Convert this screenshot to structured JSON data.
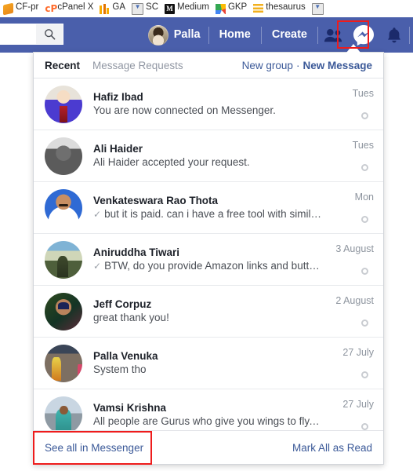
{
  "bookmarks": [
    {
      "label": "CF-pr",
      "icon": "cfpr-icon"
    },
    {
      "label": "cPanel X",
      "icon": "cpanel-icon"
    },
    {
      "label": "GA",
      "icon": "google-analytics-icon"
    },
    {
      "label": "SC",
      "icon": "search-console-icon"
    },
    {
      "label": "Medium",
      "icon": "medium-icon"
    },
    {
      "label": "GKP",
      "icon": "google-keyword-planner-icon"
    },
    {
      "label": "thesaurus",
      "icon": "thesaurus-icon"
    },
    {
      "label": "",
      "icon": "chevron-down-icon"
    }
  ],
  "navbar": {
    "search_placeholder": "",
    "search_value": "",
    "search_icon": "search-icon",
    "profile_name": "Palla",
    "home_label": "Home",
    "create_label": "Create",
    "friends_icon": "friend-requests-icon",
    "messenger_icon": "messenger-icon",
    "notifications_icon": "bell-icon",
    "accent_blue": "#4a5fab",
    "highlight_color": "#ee1c1c"
  },
  "dropdown": {
    "tab_recent": "Recent",
    "tab_message_requests": "Message Requests",
    "new_group_label": "New group",
    "separator": "·",
    "new_message_label": "New Message",
    "link_color": "#3b5998",
    "threads": [
      {
        "name": "Hafiz Ibad",
        "snippet": "You are now connected on Messenger.",
        "time": "Tues",
        "has_tick": false,
        "avatar": "av1"
      },
      {
        "name": "Ali Haider",
        "snippet": "Ali Haider accepted your request.",
        "time": "Tues",
        "has_tick": false,
        "avatar": "av2"
      },
      {
        "name": "Venkateswara Rao Thota",
        "snippet": "but it is paid. can i have a free tool with similar featur...",
        "time": "Mon",
        "has_tick": true,
        "avatar": "av3"
      },
      {
        "name": "Aniruddha Tiwari",
        "snippet": "BTW, do you provide Amazon links and button types....",
        "time": "3 August",
        "has_tick": true,
        "avatar": "av4"
      },
      {
        "name": "Jeff Corpuz",
        "snippet": "great thank you!",
        "time": "2 August",
        "has_tick": false,
        "avatar": "av5"
      },
      {
        "name": "Palla Venuka",
        "snippet": "System tho",
        "time": "27 July",
        "has_tick": false,
        "avatar": "av6"
      },
      {
        "name": "Vamsi Krishna",
        "snippet": "All people are Gurus who give you wings to fly. Guru is ...",
        "time": "27 July",
        "has_tick": false,
        "avatar": "av7"
      }
    ],
    "footer": {
      "see_all_label": "See all in Messenger",
      "mark_all_read_label": "Mark All as Read"
    }
  }
}
